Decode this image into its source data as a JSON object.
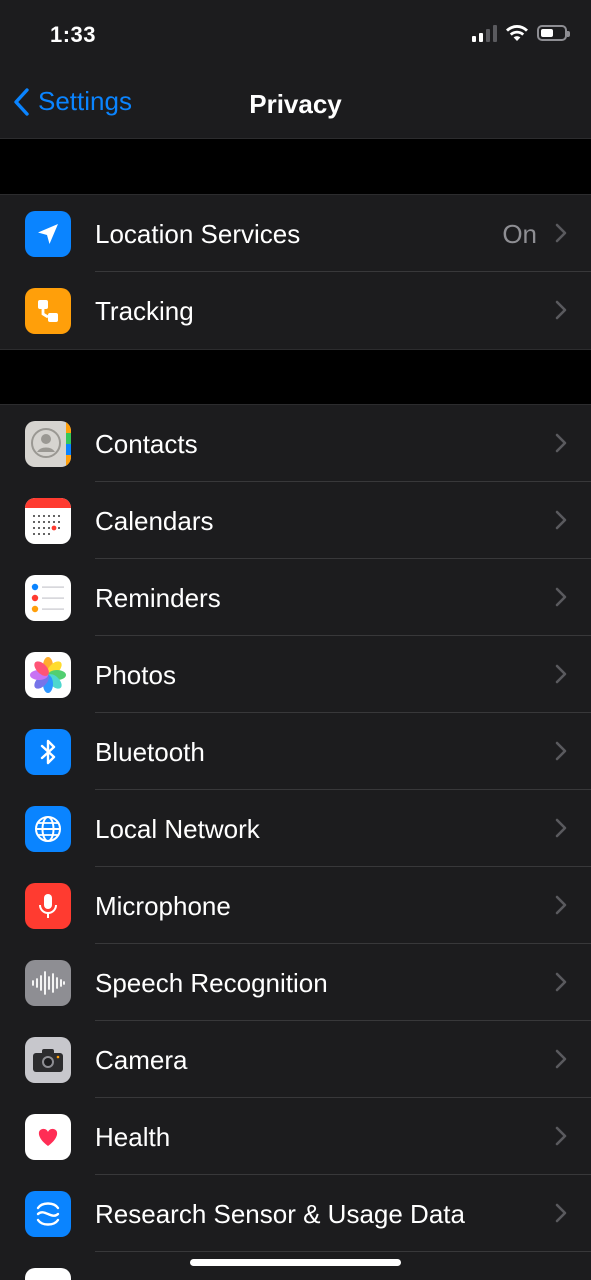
{
  "status_bar": {
    "time": "1:33"
  },
  "nav": {
    "back_label": "Settings",
    "title": "Privacy"
  },
  "groups": [
    {
      "items": [
        {
          "label": "Location Services",
          "value": "On",
          "icon": "location-arrow-icon",
          "color": "#0a84ff"
        },
        {
          "label": "Tracking",
          "value": "",
          "icon": "tracking-icon",
          "color": "#ff9f0a"
        }
      ]
    },
    {
      "items": [
        {
          "label": "Contacts",
          "icon": "contacts-icon",
          "color": "#d1d1d6"
        },
        {
          "label": "Calendars",
          "icon": "calendar-icon",
          "color": "#ffffff"
        },
        {
          "label": "Reminders",
          "icon": "reminders-icon",
          "color": "#ffffff"
        },
        {
          "label": "Photos",
          "icon": "photos-icon",
          "color": "#ffffff"
        },
        {
          "label": "Bluetooth",
          "icon": "bluetooth-icon",
          "color": "#0a84ff"
        },
        {
          "label": "Local Network",
          "icon": "globe-icon",
          "color": "#0a84ff"
        },
        {
          "label": "Microphone",
          "icon": "microphone-icon",
          "color": "#ff3b30"
        },
        {
          "label": "Speech Recognition",
          "icon": "waveform-icon",
          "color": "#8e8e93"
        },
        {
          "label": "Camera",
          "icon": "camera-icon",
          "color": "#aeaeb2"
        },
        {
          "label": "Health",
          "icon": "heart-icon",
          "color": "#ffffff"
        },
        {
          "label": "Research Sensor & Usage Data",
          "icon": "research-icon",
          "color": "#0a84ff"
        },
        {
          "label": "",
          "icon": "homekit-icon",
          "color": "#ffffff"
        }
      ]
    }
  ]
}
